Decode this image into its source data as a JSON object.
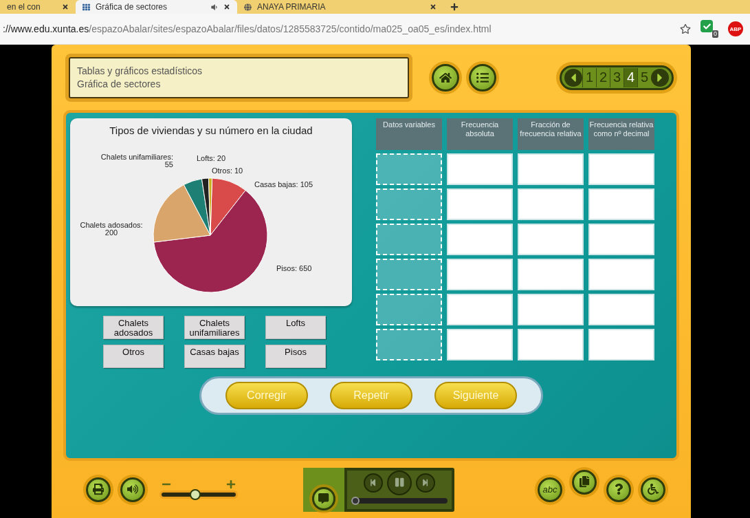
{
  "browser": {
    "tabs": [
      {
        "title": "en el con",
        "selected": false
      },
      {
        "title": "Gráfica de sectores",
        "selected": true
      },
      {
        "title": "ANAYA PRIMARIA",
        "selected": false
      }
    ],
    "url_host": "://www.edu.xunta.es",
    "url_path": "/espazoAbalar/sites/espazoAbalar/files/datos/1285583725/contido/ma025_oa05_es/index.html",
    "extension_badge": "0",
    "adblock_label": "ABP"
  },
  "header": {
    "title_lines": [
      "Tablas y gráficos estadísticos",
      "Gráfica de sectores"
    ],
    "pages": [
      {
        "label": "1",
        "selected": false
      },
      {
        "label": "2",
        "selected": false
      },
      {
        "label": "3",
        "selected": false
      },
      {
        "label": "4",
        "selected": true
      },
      {
        "label": "5",
        "selected": false
      }
    ]
  },
  "chart": {
    "chart_data": {
      "type": "pie",
      "title": "Tipos de viviendas y su número en la ciudad",
      "categories": [
        "Casas bajas: 105",
        "Pisos: 650",
        "Chalets adosados: 200",
        "Chalets unifamiliares: 55",
        "Lofts: 20",
        "Otros: 10"
      ],
      "values": [
        105,
        650,
        200,
        55,
        20,
        10
      ]
    }
  },
  "tiles": [
    "Chalets adosados",
    "Chalets unifamiliares",
    "Lofts",
    "Otros",
    "Casas bajas",
    "Pisos"
  ],
  "table": {
    "columns": [
      "Datos variables",
      "Frecuencia absoluta",
      "Fracción de frecuencia relativa",
      "Frecuencia relativa como nº decimal"
    ],
    "rows": [
      {
        "kind": "blank"
      },
      {
        "kind": "blank"
      },
      {
        "kind": "blank"
      },
      {
        "kind": "blank"
      },
      {
        "kind": "blank"
      },
      {
        "kind": "blank"
      }
    ]
  },
  "actions": [
    "Corregir",
    "Repetir",
    "Siguiente"
  ],
  "footer": {
    "volume": {
      "level": 0.45
    },
    "player": {
      "level": 0
    },
    "glossary_label": "abc"
  }
}
